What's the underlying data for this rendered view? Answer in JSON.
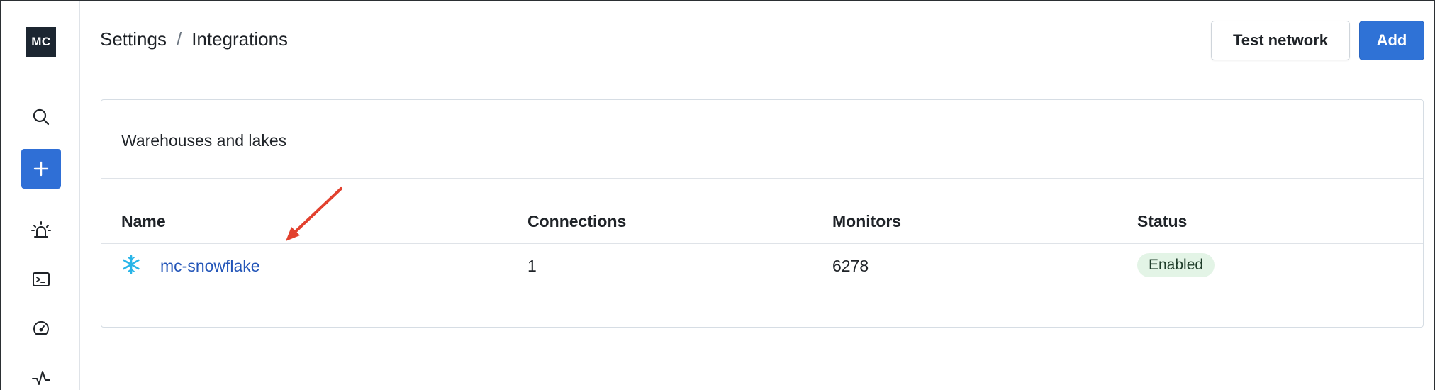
{
  "app": {
    "logo_text": "MC"
  },
  "sidebar": {
    "items": [
      {
        "name": "search",
        "icon": "search-icon"
      },
      {
        "name": "add",
        "icon": "plus-icon"
      },
      {
        "name": "alerts",
        "icon": "siren-icon"
      },
      {
        "name": "terminal",
        "icon": "terminal-icon"
      },
      {
        "name": "dashboard",
        "icon": "gauge-icon"
      },
      {
        "name": "activity",
        "icon": "pulse-icon"
      }
    ]
  },
  "header": {
    "breadcrumb": [
      "Settings",
      "Integrations"
    ],
    "separator": "/",
    "test_network_label": "Test network",
    "add_label": "Add"
  },
  "card": {
    "title": "Warehouses and lakes",
    "columns": [
      "Name",
      "Connections",
      "Monitors",
      "Status"
    ],
    "rows": [
      {
        "icon": "snowflake-icon",
        "name": "mc-snowflake",
        "connections": "1",
        "monitors": "6278",
        "status": "Enabled"
      }
    ]
  },
  "colors": {
    "accent": "#2f72d6",
    "link": "#2355b8",
    "status_enabled_bg": "#e3f4e6",
    "annotation": "#e2412e",
    "logo_bg": "#1c2631"
  }
}
